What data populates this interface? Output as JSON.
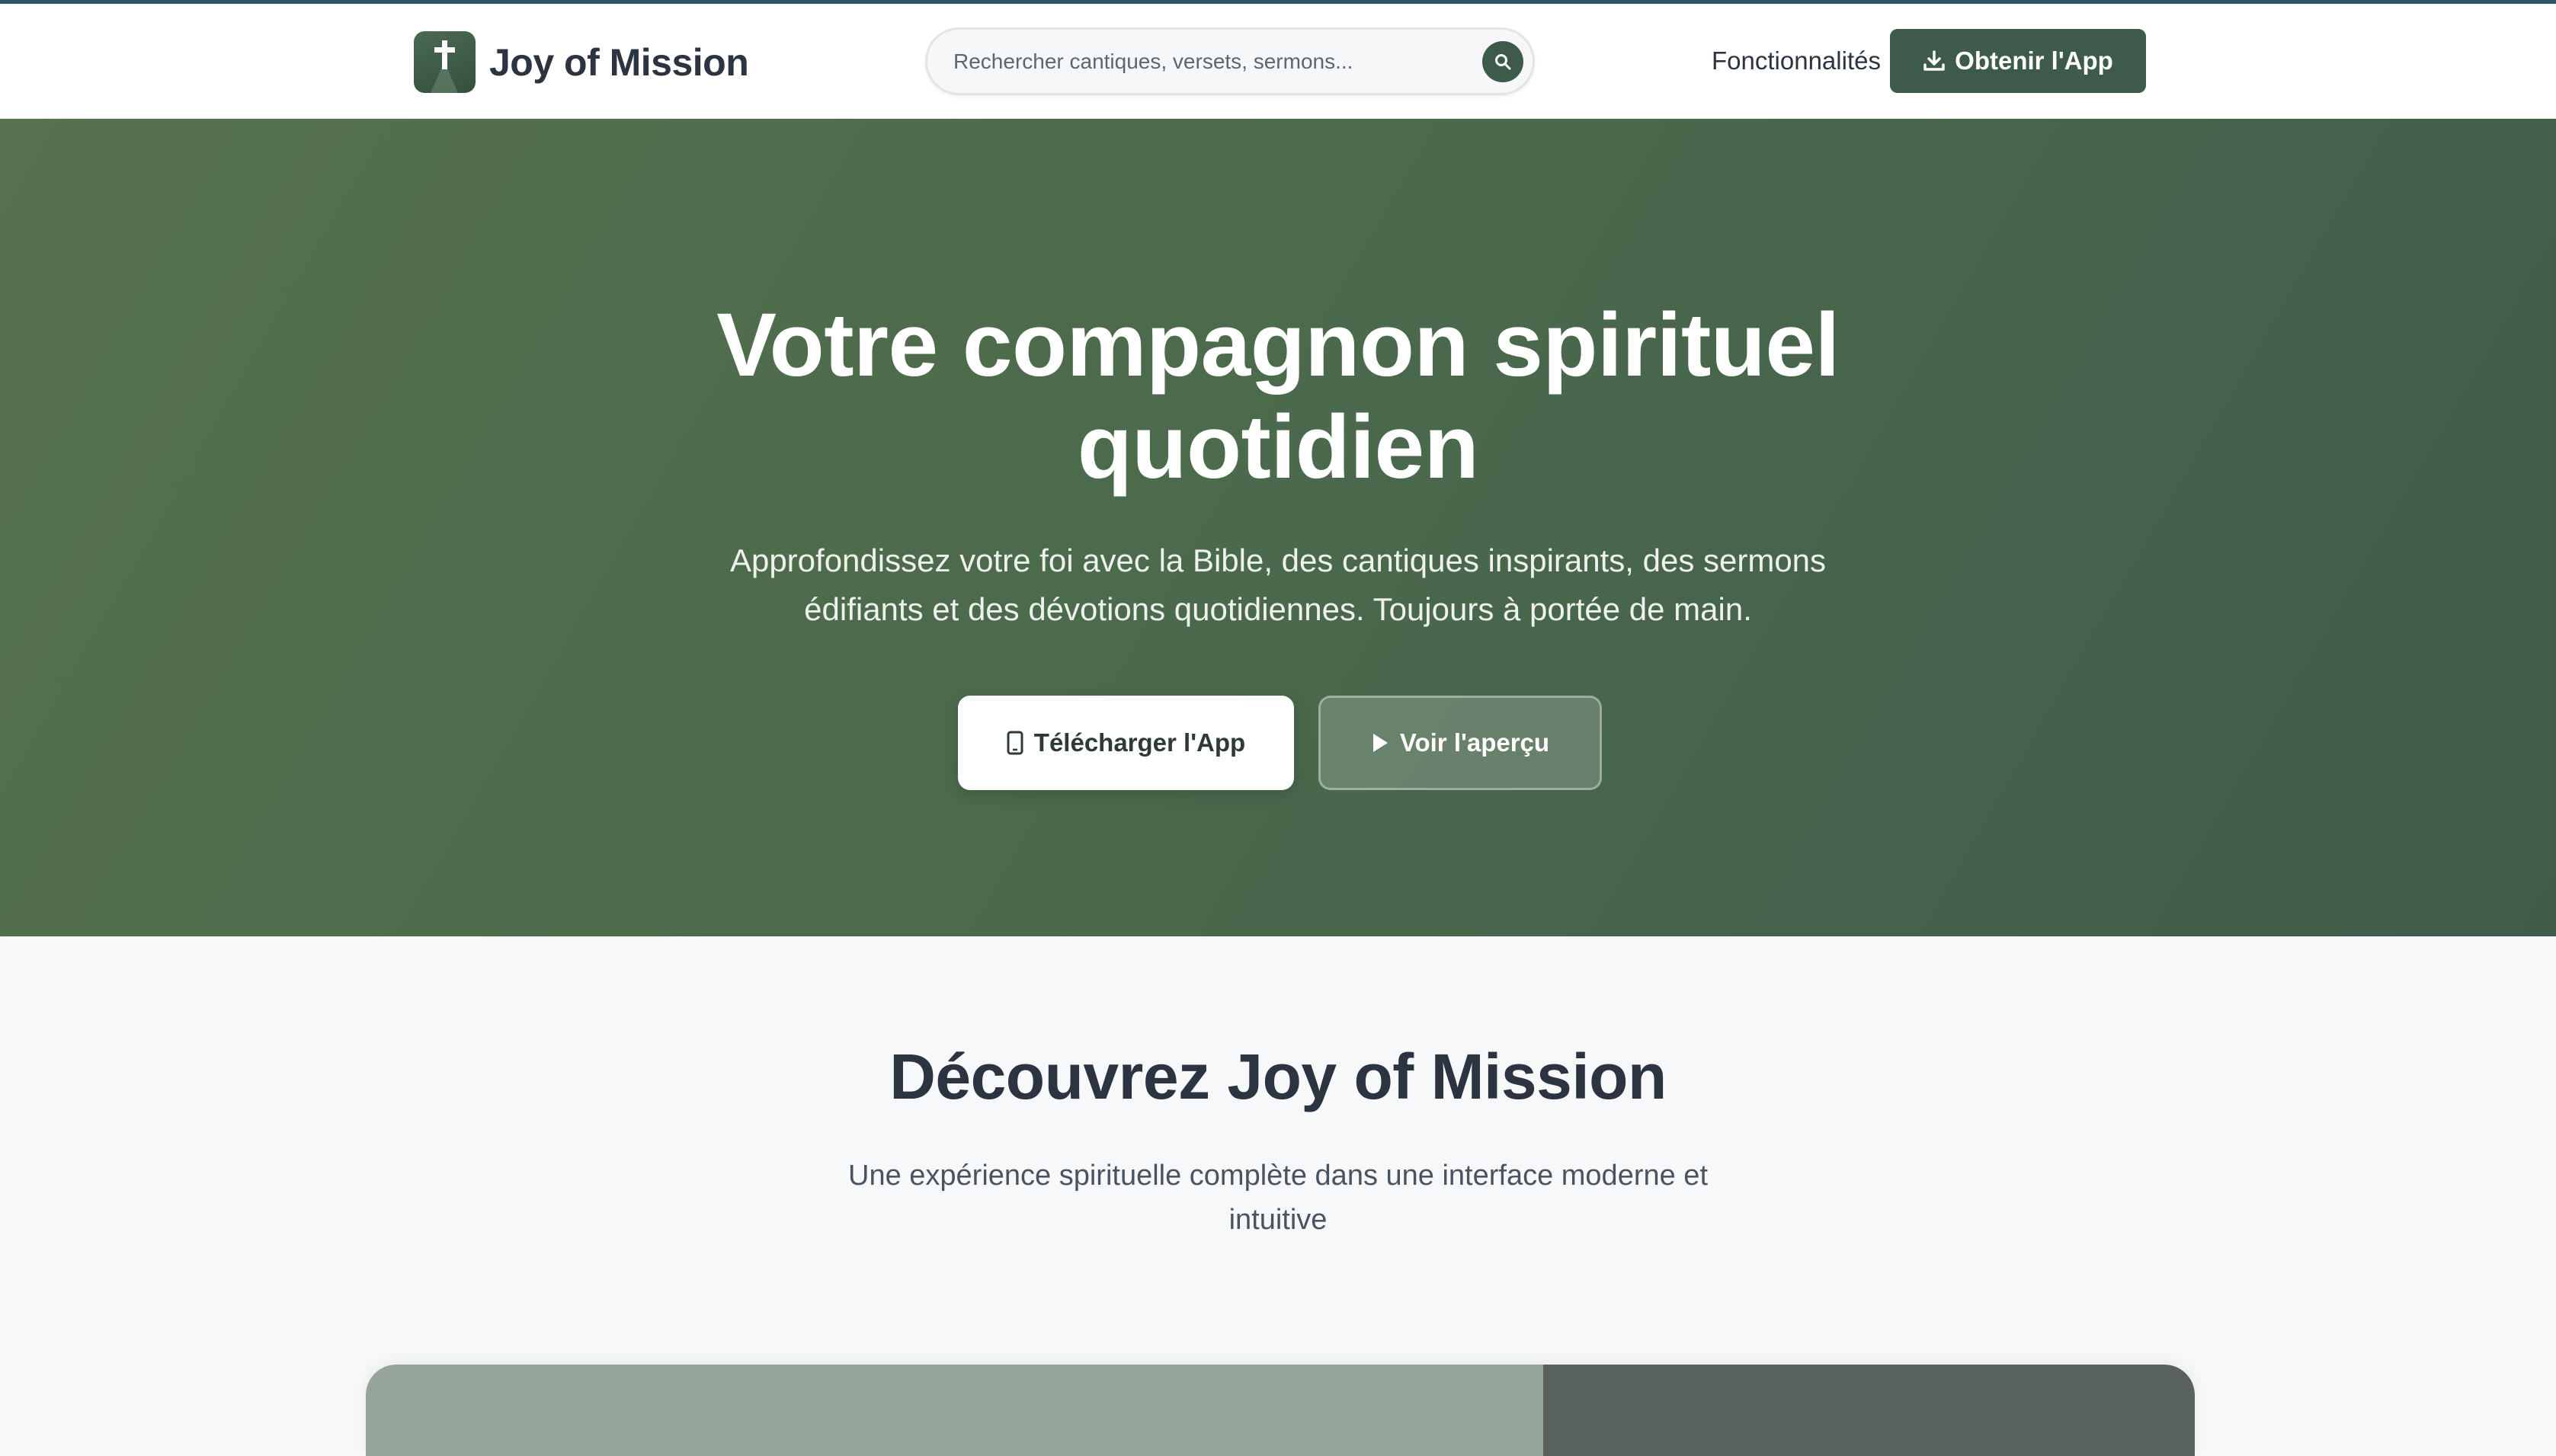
{
  "brand": {
    "name": "Joy of Mission",
    "icon": "cross-icon",
    "accent": "#3d5a4a"
  },
  "search": {
    "placeholder": "Rechercher cantiques, versets, sermons...",
    "value": "",
    "icon": "search-icon"
  },
  "nav": {
    "features_label": "Fonctionnalités",
    "get_app_label": "Obtenir l'App",
    "get_app_icon": "download-icon"
  },
  "hero": {
    "title": "Votre compagnon spirituel quotidien",
    "subtitle": "Approfondissez votre foi avec la Bible, des cantiques inspirants, des sermons édifiants et des dévotions quotidiennes. Toujours à portée de main.",
    "download_label": "Télécharger l'App",
    "download_icon": "mobile-icon",
    "preview_label": "Voir l'aperçu",
    "preview_icon": "play-icon",
    "bg_color": "#4c6a4c"
  },
  "discover": {
    "title": "Découvrez Joy of Mission",
    "subtitle": "Une expérience spirituelle complète dans une interface moderne et intuitive"
  }
}
